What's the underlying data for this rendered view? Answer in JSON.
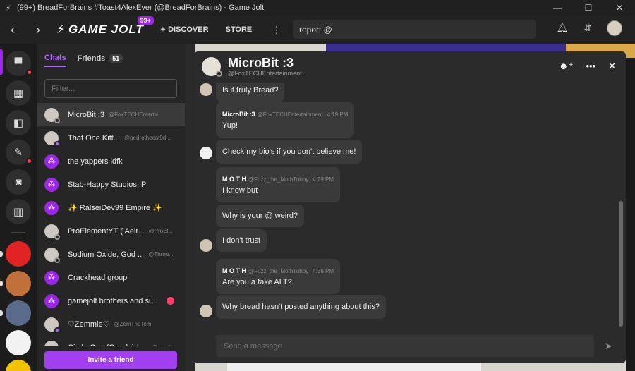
{
  "window": {
    "title": "(99+) BreadForBrains #Toast4AlexEver (@BreadForBrains) - Game Jolt",
    "app_icon": "⚡",
    "min": "—",
    "max": "☐",
    "close": "✕"
  },
  "topnav": {
    "back": "‹",
    "forward": "›",
    "logo_text": "GAME JOLT",
    "logo_badge": "99+",
    "discover_label": "DISCOVER",
    "store_label": "STORE",
    "more_icon": "⋮",
    "search_value": "report @"
  },
  "chat_sidebar": {
    "tab_chats": "Chats",
    "tab_friends": "Friends",
    "friends_count": "51",
    "filter_placeholder": "Filter...",
    "invite_label": "Invite a friend",
    "chats": [
      {
        "name": "MicroBit :3",
        "handle": "@FoxTECHEntertainment",
        "kind": "user",
        "status": "offline",
        "active": true
      },
      {
        "name": "That One Kitt...",
        "handle": "@pedrothecat9d...",
        "kind": "user",
        "status": "online"
      },
      {
        "name": "the yappers idfk",
        "handle": "",
        "kind": "group"
      },
      {
        "name": "Stab-Happy Studios :P",
        "handle": "",
        "kind": "group"
      },
      {
        "name": "✨ RalseiDev99 Empire ✨",
        "handle": "",
        "kind": "group"
      },
      {
        "name": "ProElementYT ( Aelr...",
        "handle": "@ProEl...",
        "kind": "user",
        "status": "offline"
      },
      {
        "name": "Sodium Oxide, God ...",
        "handle": "@Throu...",
        "kind": "user",
        "status": "offline"
      },
      {
        "name": "Crackhead group",
        "handle": "",
        "kind": "group"
      },
      {
        "name": "gamejolt brothers and si...",
        "handle": "",
        "kind": "group",
        "unread": true
      },
      {
        "name": "♡Zemmie♡",
        "handle": "@ZemTheTem",
        "kind": "user",
        "status": "online"
      },
      {
        "name": "Circle Guy (Geode) I ...",
        "handle": "@geod...",
        "kind": "user",
        "status": "online"
      }
    ]
  },
  "chat": {
    "name": "MicroBit :3",
    "handle": "@FoxTECHEntertainment",
    "add_friend_icon": "☻⁺",
    "more_icon": "•••",
    "close_icon": "✕",
    "messages": [
      {
        "author": "",
        "handle": "",
        "time": "",
        "text": "Is it truly Bread?"
      },
      {
        "author": "MicroBit :3",
        "handle": "@FoxTECHEntertainment",
        "time": "4:19 PM",
        "text": "Yup!"
      },
      {
        "author": "",
        "handle": "",
        "time": "",
        "text": "Check my bio's if you don't believe me!"
      },
      {
        "author": "M O T H",
        "handle": "@Fuzz_the_MothTubby",
        "time": "4:29 PM",
        "text": "I know but"
      },
      {
        "author": "",
        "handle": "",
        "time": "",
        "text": "Why is your @ weird?"
      },
      {
        "author": "",
        "handle": "",
        "time": "",
        "text": "I don't trust"
      },
      {
        "author": "M O T H",
        "handle": "@Fuzz_the_MothTubby",
        "time": "4:36 PM",
        "text": "Are you a fake ALT?"
      },
      {
        "author": "",
        "handle": "",
        "time": "",
        "text": "Why bread hasn't posted anything about this?"
      }
    ],
    "composer_placeholder": "Send a message",
    "send_icon": "➤"
  },
  "colors": {
    "accent": "#9c27e8",
    "unread": "#ff3d6a"
  }
}
